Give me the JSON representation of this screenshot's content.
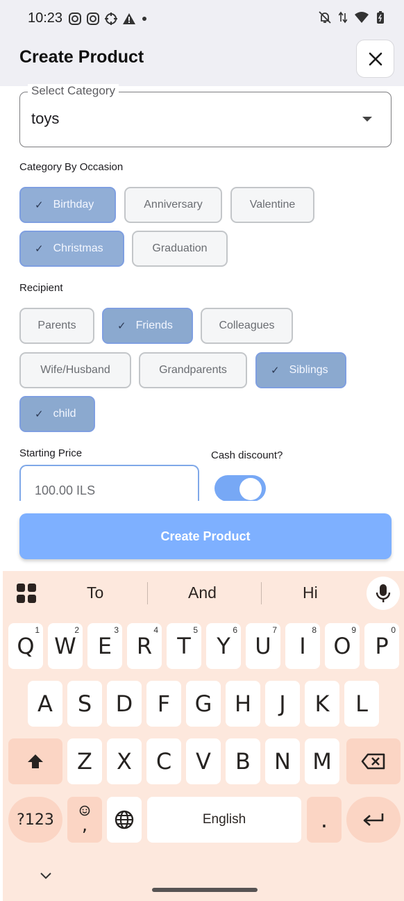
{
  "status_bar": {
    "time": "10:23",
    "left_icons": [
      "instagram-icon",
      "instagram-icon",
      "settings-target-icon",
      "warning-icon",
      "dot-icon"
    ],
    "right_icons": [
      "bell-off-icon",
      "data-arrows-icon",
      "wifi-icon",
      "battery-icon"
    ]
  },
  "appbar": {
    "title": "Create Product",
    "close_icon": "close-icon"
  },
  "category": {
    "legend": "Select Category",
    "value": "toys"
  },
  "occasion": {
    "label": "Category By Occasion",
    "chips": [
      {
        "label": "Birthday",
        "selected": true
      },
      {
        "label": "Anniversary",
        "selected": false
      },
      {
        "label": "Valentine",
        "selected": false
      },
      {
        "label": "Christmas",
        "selected": true
      },
      {
        "label": "Graduation",
        "selected": false
      }
    ]
  },
  "recipient": {
    "label": "Recipient",
    "chips": [
      {
        "label": "Parents",
        "selected": false
      },
      {
        "label": "Friends",
        "selected": true
      },
      {
        "label": "Colleagues",
        "selected": false
      },
      {
        "label": "Wife/Husband",
        "selected": false
      },
      {
        "label": "Grandparents",
        "selected": false
      },
      {
        "label": "Siblings",
        "selected": true
      },
      {
        "label": "child",
        "selected": true
      }
    ]
  },
  "price": {
    "label": "Starting Price",
    "value": "100.00 ILS"
  },
  "cash_discount": {
    "label": "Cash discount?",
    "enabled": true
  },
  "create_button": {
    "label": "Create Product"
  },
  "keyboard": {
    "suggestions": [
      "To",
      "And",
      "Hi"
    ],
    "row1": [
      {
        "key": "Q",
        "hint": "1"
      },
      {
        "key": "W",
        "hint": "2"
      },
      {
        "key": "E",
        "hint": "3"
      },
      {
        "key": "R",
        "hint": "4"
      },
      {
        "key": "T",
        "hint": "5"
      },
      {
        "key": "Y",
        "hint": "6"
      },
      {
        "key": "U",
        "hint": "7"
      },
      {
        "key": "I",
        "hint": "8"
      },
      {
        "key": "O",
        "hint": "9"
      },
      {
        "key": "P",
        "hint": "0"
      }
    ],
    "row2": [
      "A",
      "S",
      "D",
      "F",
      "G",
      "H",
      "J",
      "K",
      "L"
    ],
    "row3": [
      "Z",
      "X",
      "C",
      "V",
      "B",
      "N",
      "M"
    ],
    "symbols_key": "?123",
    "emoji_comma": ",",
    "space_label": "English",
    "period_key": ".",
    "accent_color": "#fbd5c4",
    "background_color": "#fde8dd"
  }
}
